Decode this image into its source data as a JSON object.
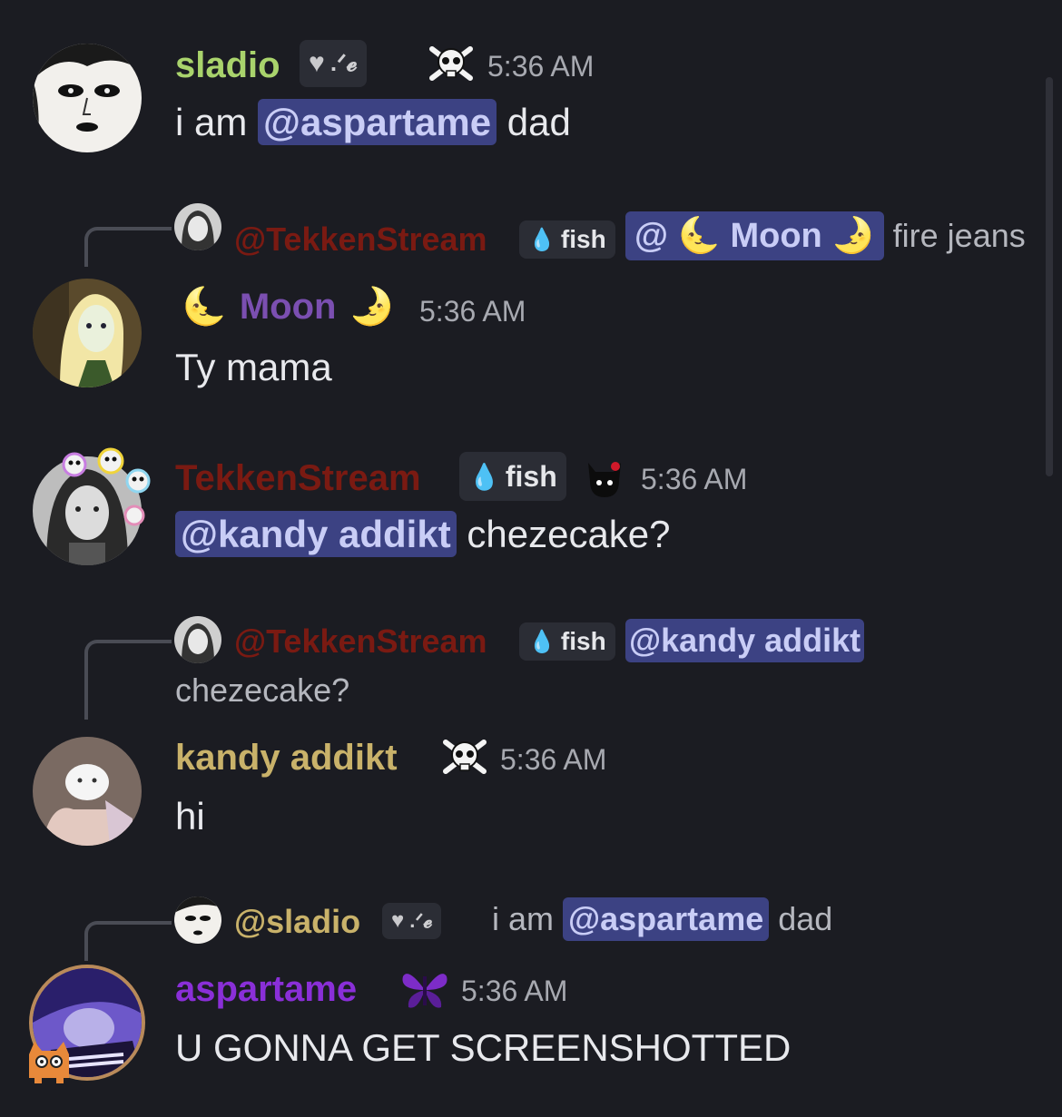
{
  "messages": [
    {
      "username": "sladio",
      "server_tag": ".ᐟ𝓮",
      "timestamp": "5:36 AM",
      "text_before": "i am ",
      "mention": "@aspartame",
      "text_after": " dad",
      "colors": {
        "name": "#a9d36c"
      }
    },
    {
      "reply": {
        "username": "@TekkenStream",
        "tag": "fish",
        "mention": "@ 🌜 Moon 🌛",
        "text": "fire jeans"
      },
      "username": "Moon",
      "timestamp": "5:36 AM",
      "text": "Ty mama",
      "colors": {
        "name": "#7b4fb1"
      }
    },
    {
      "username": "TekkenStream",
      "tag": "fish",
      "timestamp": "5:36 AM",
      "mention": "@kandy addikt",
      "text_after": " chezecake?",
      "colors": {
        "name": "#7a1a12"
      }
    },
    {
      "reply": {
        "username": "@TekkenStream",
        "tag": "fish",
        "mention": "@kandy addikt",
        "text": "chezecake?"
      },
      "username": "kandy addikt",
      "timestamp": "5:36 AM",
      "text": "hi",
      "colors": {
        "name": "#c9b26a"
      }
    },
    {
      "reply": {
        "username": "@sladio",
        "tag": ".ᐟ𝓮",
        "text_before": "i am ",
        "mention": "@aspartame",
        "text_after": " dad"
      },
      "username": "aspartame",
      "timestamp": "5:36 AM",
      "text": "U GONNA GET SCREENSHOTTED",
      "colors": {
        "name": "#8a2fd8"
      }
    }
  ],
  "icons": {
    "skull_crossbones": "skull-crossbones-icon",
    "droplet": "water-drop-icon",
    "heart": "heart-icon",
    "moon_left": "🌜",
    "moon_right": "🌛",
    "butterfly": "butterfly-icon",
    "cat": "cat-icon",
    "demon": "demon-icon"
  },
  "accent": {
    "mention_bg": "#3c4283",
    "mention_text": "#c9cdf6",
    "background": "#1b1c22"
  }
}
